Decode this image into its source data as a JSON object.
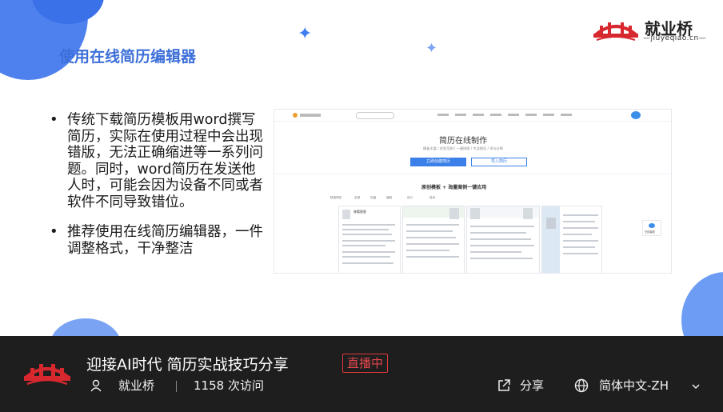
{
  "slide": {
    "title": "使用在线简历编辑器",
    "brand": {
      "name": "就业桥",
      "url": "—jiuyeqiao.cn—"
    },
    "bullets": [
      "传统下载简历模板用word撰写简历，实际在使用过程中会出现错版，无法正确缩进等一系列问题。同时，word简历在发送他人时，可能会因为设备不同或者软件不同导致错位。",
      "推荐使用在线简历编辑器，一件调整格式，干净整洁"
    ],
    "screenshot": {
      "heading": "简历在线制作",
      "subheading": "模板丰富 / 优质范例 / 一键排版 / 专业指导 / 评分诊断",
      "primary_button": "立即创建简历",
      "secondary_button": "导入简历",
      "section_title": "原创模板 + 海量案例一键应用",
      "tabs": [
        "精选简历",
        "全部",
        "应届",
        "通用",
        "设计",
        "技术"
      ],
      "resume_name": "林看星星",
      "side_button": "在线客服"
    }
  },
  "stream": {
    "title": "迎接AI时代 简历实战技巧分享",
    "live_badge": "直播中",
    "host": "就业桥",
    "visits": "1158 次访问",
    "share": "分享",
    "language": "简体中文-ZH"
  },
  "colors": {
    "accent": "#3d6fd9",
    "live": "#e5484d",
    "bar": "#1e1e1e"
  }
}
